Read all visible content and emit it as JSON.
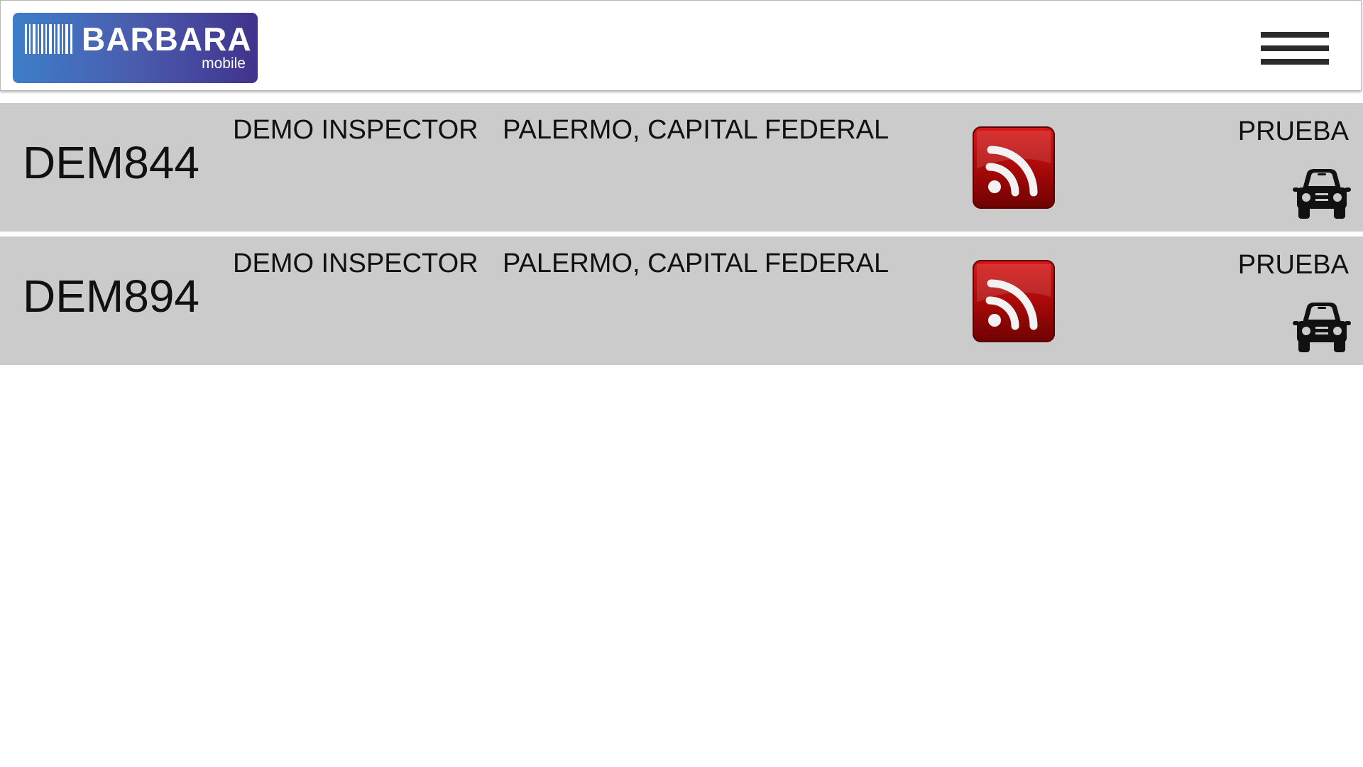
{
  "header": {
    "logo": {
      "name": "BARBARA",
      "sub": "mobile"
    },
    "menu_icon": "hamburger-menu-icon"
  },
  "colors": {
    "row_background": "#cbcbcb",
    "rss_red": "#c00d0d",
    "logo_gradient_start": "#3e7ec8",
    "logo_gradient_end": "#40338c"
  },
  "rows": [
    {
      "plate": "DEM844",
      "inspector": "DEMO INSPECTOR",
      "location": "PALERMO, CAPITAL FEDERAL",
      "status": "PRUEBA",
      "feed_icon": "rss-feed-icon",
      "vehicle_icon": "car-icon"
    },
    {
      "plate": "DEM894",
      "inspector": "DEMO INSPECTOR",
      "location": "PALERMO, CAPITAL FEDERAL",
      "status": "PRUEBA",
      "feed_icon": "rss-feed-icon",
      "vehicle_icon": "car-icon"
    }
  ]
}
